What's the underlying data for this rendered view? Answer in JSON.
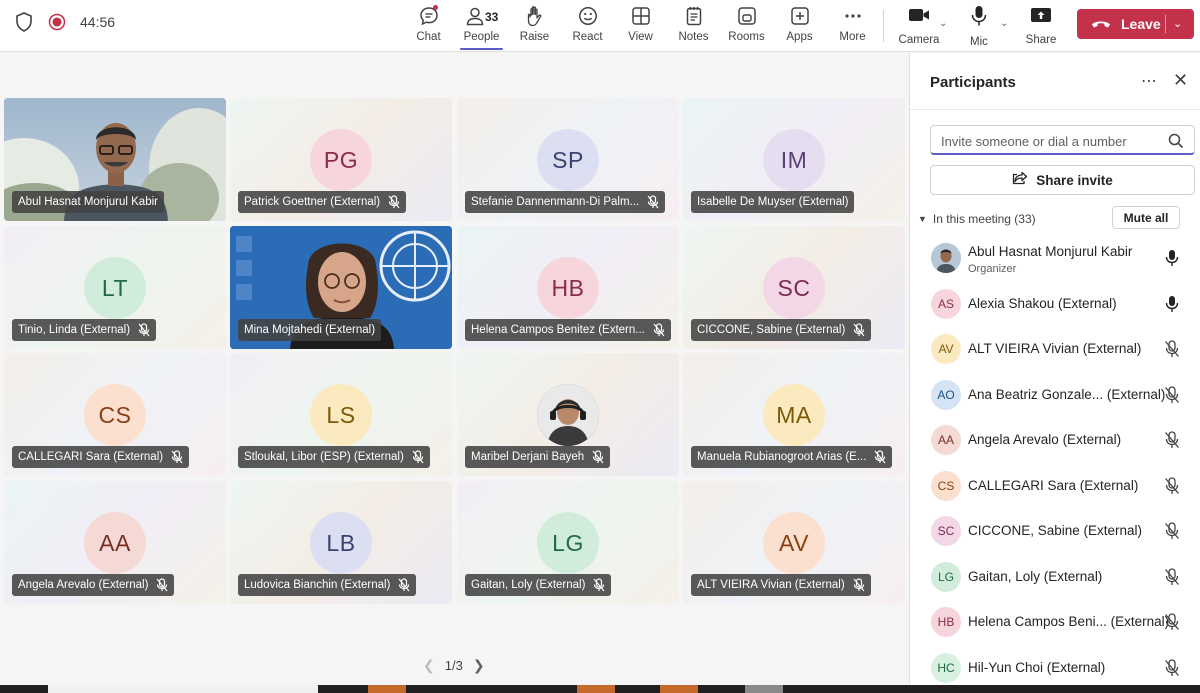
{
  "meeting": {
    "timer": "44:56"
  },
  "toolbar": {
    "chat": "Chat",
    "people": "People",
    "people_count": "33",
    "raise": "Raise",
    "react": "React",
    "view": "View",
    "notes": "Notes",
    "rooms": "Rooms",
    "apps": "Apps",
    "more": "More",
    "camera": "Camera",
    "mic": "Mic",
    "share": "Share",
    "leave": "Leave"
  },
  "grid": {
    "tiles": [
      {
        "name": "Abul Hasnat Monjurul Kabir",
        "initials": "",
        "kind": "video",
        "muted": false
      },
      {
        "name": "Patrick Goettner (External)",
        "initials": "PG",
        "kind": "avatar",
        "muted": true
      },
      {
        "name": "Stefanie Dannenmann-Di Palm...",
        "initials": "SP",
        "kind": "avatar",
        "muted": true
      },
      {
        "name": "Isabelle De Muyser (External)",
        "initials": "IM",
        "kind": "avatar",
        "muted": false
      },
      {
        "name": "Tinio, Linda (External)",
        "initials": "LT",
        "kind": "avatar",
        "muted": true
      },
      {
        "name": "Mina Mojtahedi (External)",
        "initials": "",
        "kind": "video",
        "muted": false
      },
      {
        "name": "Helena Campos Benitez (Extern...",
        "initials": "HB",
        "kind": "avatar",
        "muted": true
      },
      {
        "name": "CICCONE, Sabine (External)",
        "initials": "SC",
        "kind": "avatar",
        "muted": true
      },
      {
        "name": "CALLEGARI Sara (External)",
        "initials": "CS",
        "kind": "avatar",
        "muted": true
      },
      {
        "name": "Stloukal, Libor (ESP) (External)",
        "initials": "LS",
        "kind": "avatar",
        "muted": true
      },
      {
        "name": "Maribel Derjani Bayeh",
        "initials": "",
        "kind": "photo",
        "muted": true
      },
      {
        "name": "Manuela Rubianogroot Arias (E...",
        "initials": "MA",
        "kind": "avatar",
        "muted": true
      },
      {
        "name": "Angela Arevalo (External)",
        "initials": "AA",
        "kind": "avatar",
        "muted": true
      },
      {
        "name": "Ludovica Bianchin (External)",
        "initials": "LB",
        "kind": "avatar",
        "muted": true
      },
      {
        "name": "Gaitan, Loly (External)",
        "initials": "LG",
        "kind": "avatar",
        "muted": true
      },
      {
        "name": "ALT VIEIRA Vivian (External)",
        "initials": "AV",
        "kind": "avatar",
        "muted": true
      }
    ],
    "pager": "1/3"
  },
  "panel": {
    "title": "Participants",
    "invite_placeholder": "Invite someone or dial a number",
    "share_invite": "Share invite",
    "section_label": "In this meeting (33)",
    "mute_all": "Mute all",
    "participants": [
      {
        "initials": "",
        "name": "Abul Hasnat Monjurul Kabir",
        "role": "Organizer",
        "mic": "on"
      },
      {
        "initials": "AS",
        "name": "Alexia Shakou (External)",
        "role": "",
        "mic": "on"
      },
      {
        "initials": "AV",
        "name": "ALT VIEIRA Vivian (External)",
        "role": "",
        "mic": "off"
      },
      {
        "initials": "AO",
        "name": "Ana Beatriz Gonzale...  (External)",
        "role": "",
        "mic": "off"
      },
      {
        "initials": "AA",
        "name": "Angela Arevalo (External)",
        "role": "",
        "mic": "off"
      },
      {
        "initials": "CS",
        "name": "CALLEGARI Sara (External)",
        "role": "",
        "mic": "off"
      },
      {
        "initials": "SC",
        "name": "CICCONE, Sabine (External)",
        "role": "",
        "mic": "off"
      },
      {
        "initials": "LG",
        "name": "Gaitan, Loly (External)",
        "role": "",
        "mic": "off"
      },
      {
        "initials": "HB",
        "name": "Helena Campos Beni...  (External)",
        "role": "",
        "mic": "off"
      },
      {
        "initials": "HC",
        "name": "Hil-Yun Choi (External)",
        "role": "",
        "mic": "off"
      }
    ]
  },
  "colors": {
    "accent": "#5b5fc7",
    "leave": "#c4314b",
    "name_tag": "#424242"
  }
}
